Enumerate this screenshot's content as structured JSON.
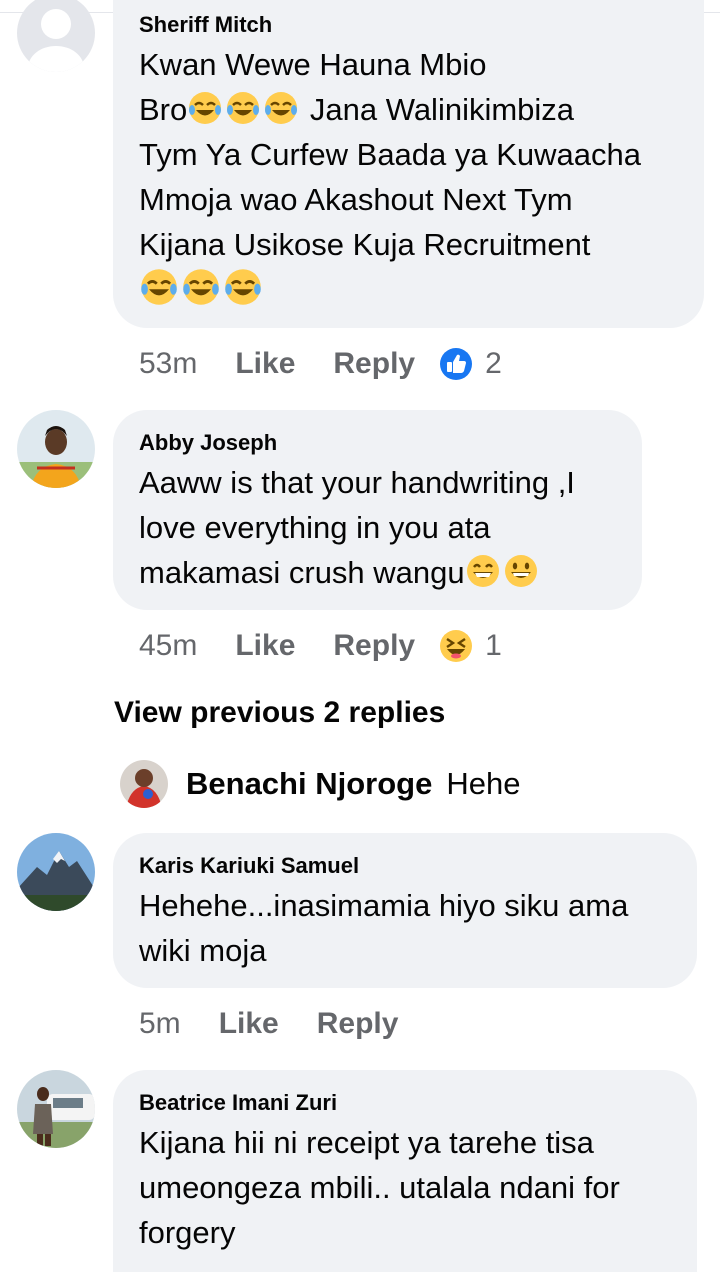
{
  "comments": [
    {
      "author": "Sheriff Mitch",
      "lines": [
        "Kwan Wewe Hauna Mbio",
        "Jana Walinikimbiza",
        "Tym Ya Curfew Baada ya Kuwaacha",
        "Mmoja wao Akashout Next Tym",
        "Kijana Usikose Kuja Recruitment"
      ],
      "bro_prefix": "Bro",
      "emoji_name": "face-with-tears-of-joy",
      "time": "53m",
      "like": "Like",
      "reply": "Reply",
      "reaction": "like-reaction-icon",
      "reaction_count": "2"
    },
    {
      "author": "Abby Joseph",
      "lines": [
        "Aaww is that your handwriting ,I",
        "love everything in you ata",
        "makamasi crush wangu"
      ],
      "emojis": [
        "beaming-face",
        "grinning-face"
      ],
      "time": "45m",
      "like": "Like",
      "reply": "Reply",
      "reaction": "haha-reaction-icon",
      "reaction_count": "1"
    }
  ],
  "view_previous": "View previous 2 replies",
  "nested_reply": {
    "author": "Benachi Njoroge",
    "text": "Hehe"
  },
  "karis": {
    "author": "Karis Kariuki Samuel",
    "lines": [
      "Hehehe...inasimamia hiyo siku ama",
      "wiki moja"
    ],
    "time": "5m",
    "like": "Like",
    "reply": "Reply"
  },
  "beatrice": {
    "author": "Beatrice Imani Zuri",
    "lines": [
      "Kijana hii ni receipt ya tarehe tisa",
      "umeongeza mbili.. utalala ndani for",
      "forgery"
    ]
  },
  "colors": {
    "bubble": "#f0f2f5",
    "meta": "#65676b",
    "like_blue": "#1877f2",
    "emoji_yellow": "#ffcc4d"
  }
}
